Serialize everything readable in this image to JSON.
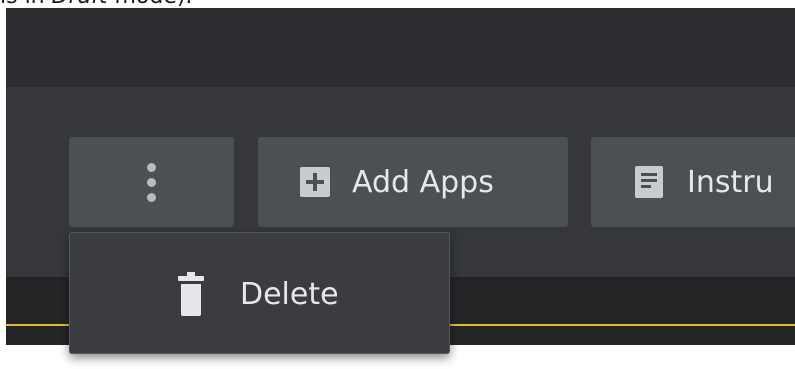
{
  "caption": {
    "prefix": "is in ",
    "emphasis": "Draft",
    "suffix": " mode)."
  },
  "toolbar": {
    "more_icon": "kebab-vertical-icon",
    "add_apps": {
      "label": "Add Apps",
      "icon": "plus-square-icon"
    },
    "instructions": {
      "label": "Instru",
      "icon": "document-icon"
    }
  },
  "dropdown": {
    "items": [
      {
        "label": "Delete",
        "icon": "trash-icon"
      }
    ]
  },
  "colors": {
    "accent": "#e7b93a",
    "toolbar_bg": "#35373a",
    "button_bg": "#4c4f53",
    "menu_bg": "#3a3c40"
  }
}
